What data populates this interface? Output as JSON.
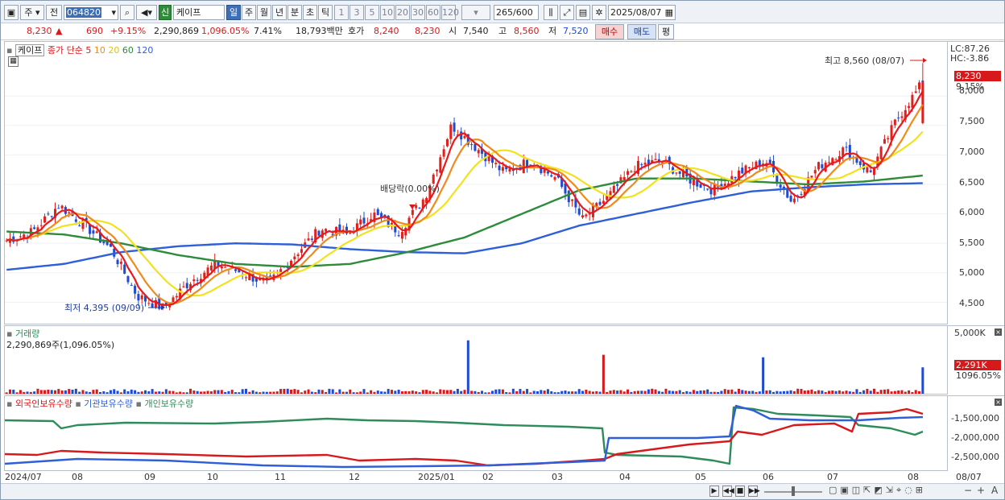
{
  "toolbar": {
    "market_label": "주",
    "prev_label": "전",
    "code": "064820",
    "badge": "신",
    "name": "케이프",
    "periods": [
      "일",
      "주",
      "월",
      "년",
      "분",
      "초",
      "틱"
    ],
    "intervals": [
      "1",
      "3",
      "5",
      "10",
      "20",
      "30",
      "60",
      "120"
    ],
    "count": "265",
    "count_max": "/600",
    "date": "2025/08/07"
  },
  "quote": {
    "price": "8,230",
    "arrow": "▲",
    "change": "690",
    "change_pct": "+9.15%",
    "volume": "2,290,869",
    "vol_pct": "1,096.05%",
    "turnover_pct": "7.41%",
    "amount": "18,793백만",
    "hoga_label": "호가",
    "hoga_ask": "8,240",
    "hoga_bid": "8,230",
    "open_label": "시",
    "open": "7,540",
    "high_label": "고",
    "high": "8,560",
    "low_label": "저",
    "low": "7,520",
    "buy_label": "매수",
    "sell_label": "매도",
    "avg_label": "평"
  },
  "price_pane": {
    "name_box": "케이프",
    "legend_prefix": "종가 단순",
    "ma_periods": [
      "5",
      "10",
      "20",
      "60",
      "120"
    ],
    "ma_colors": [
      "#e8181c",
      "#f08a1c",
      "#f2e21e",
      "#2e8b3a",
      "#2e5fd8"
    ],
    "lc": "LC:87.26",
    "hc": "HC:-3.86",
    "last_price_tag": "8,230",
    "last_pct_tag": "9.15%",
    "high_annotation": "최고 8,560 (08/07)",
    "low_annotation": "최저 4,395 (09/09)",
    "dividend_annotation": "배당락(0.00%)",
    "y_ticks": [
      "8,000",
      "7,500",
      "7,000",
      "6,500",
      "6,000",
      "5,500",
      "5,000",
      "4,500"
    ]
  },
  "volume_pane": {
    "title": "거래량",
    "value": "2,290,869주(1,096.05%)",
    "scale_top": "5,000K",
    "last_tag": "2,291K",
    "last_pct": "1096.05%"
  },
  "holding_pane": {
    "titles": [
      "외국인보유수량",
      "기관보유수량",
      "개인보유수량"
    ],
    "colors": [
      "#d7191c",
      "#2e5fd8",
      "#2e8b5a"
    ],
    "y_ticks": [
      "-1,500,000",
      "-2,000,000",
      "-2,500,000"
    ]
  },
  "x_axis": [
    "2024/07",
    "08",
    "09",
    "10",
    "11",
    "12",
    "2025/01",
    "02",
    "03",
    "04",
    "05",
    "06",
    "07",
    "08",
    "08/07"
  ],
  "chart_data": {
    "type": "candlestick",
    "ylim": [
      4300,
      8700
    ],
    "series_close_approx": [
      5550,
      5700,
      6150,
      5800,
      5400,
      4600,
      4400,
      4850,
      5150,
      5000,
      4800,
      5300,
      5750,
      5650,
      6000,
      5700,
      6300,
      7500,
      7100,
      6700,
      6900,
      6600,
      5900,
      6300,
      6800,
      6900,
      6600,
      6400,
      6700,
      6900,
      6200,
      6800,
      7100,
      6700,
      7600,
      8230
    ],
    "ma120_approx": [
      5050,
      5150,
      5350,
      5450,
      5500,
      5480,
      5400,
      5350,
      5330,
      5500,
      5800,
      6000,
      6200,
      6380,
      6450,
      6500,
      6520
    ],
    "ma60_approx": [
      5700,
      5650,
      5500,
      5300,
      5150,
      5100,
      5150,
      5350,
      5600,
      6000,
      6400,
      6600,
      6600,
      6550,
      6500,
      6550,
      6650
    ],
    "high_point": {
      "date": "08/07",
      "value": 8560
    },
    "low_point": {
      "date": "09/09",
      "value": 4395
    }
  }
}
